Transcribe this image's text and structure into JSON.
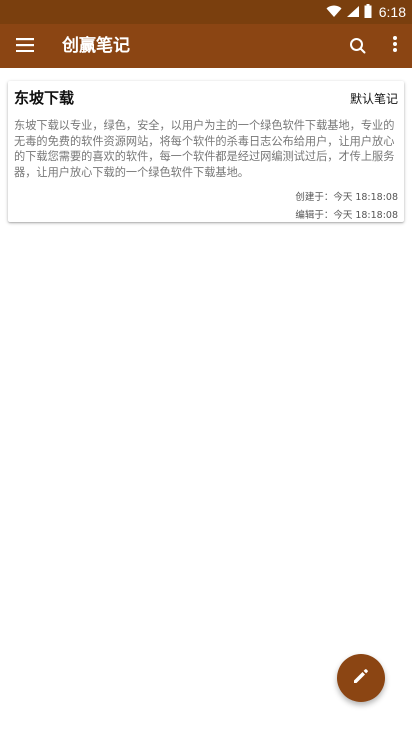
{
  "status_bar": {
    "time": "6:18",
    "icons": [
      "wifi-icon",
      "signal-icon",
      "battery-icon"
    ]
  },
  "toolbar": {
    "title": "创赢笔记",
    "menu_icon": "menu-icon",
    "search_icon": "search-icon",
    "more_icon": "more-vert-icon"
  },
  "notes": [
    {
      "title": "东坡下载",
      "category": "默认笔记",
      "body": "东坡下载以专业，绿色，安全，以用户为主的一个绿色软件下载基地，专业的无毒的免费的软件资源网站，将每个软件的杀毒日志公布给用户，让用户放心的下载您需要的喜欢的软件，每一个软件都是经过网编测试过后，才传上服务器，让用户放心下载的一个绿色软件下载基地。",
      "created": "创建于：今天  18:18:08",
      "edited": "编辑于：今天  18:18:08"
    }
  ],
  "fab": {
    "icon": "edit-icon"
  },
  "colors": {
    "status_bar": "#7a3f0e",
    "primary": "#8b4513",
    "background": "#ffffff"
  }
}
